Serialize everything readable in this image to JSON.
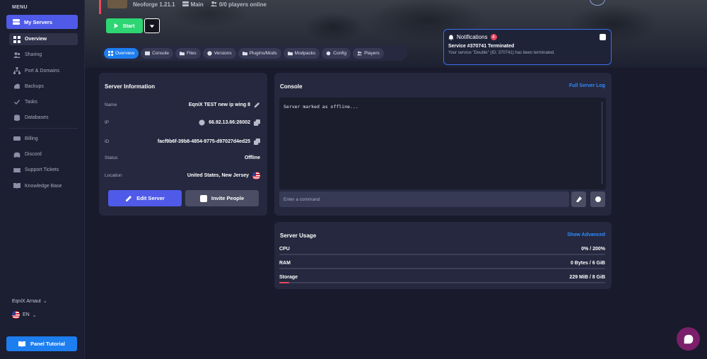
{
  "sidebar": {
    "menu_label": "MENU",
    "my_servers": "My Servers",
    "items": [
      {
        "label": "Overview",
        "icon": "grid-icon",
        "active": true
      },
      {
        "label": "Sharing",
        "icon": "users-icon"
      },
      {
        "label": "Port & Domains",
        "icon": "network-icon"
      },
      {
        "label": "Backups",
        "icon": "cloud-icon"
      },
      {
        "label": "Tasks",
        "icon": "tasks-icon"
      },
      {
        "label": "Databases",
        "icon": "database-icon"
      },
      {
        "label": "Billing",
        "icon": "billing-icon"
      },
      {
        "label": "Discord",
        "icon": "discord-icon"
      },
      {
        "label": "Support Tickets",
        "icon": "ticket-icon"
      },
      {
        "label": "Knowledge Base",
        "icon": "book-icon"
      }
    ],
    "user": "EqniX Arnaut",
    "language": "EN",
    "tutorial": "Panel Tutorial"
  },
  "header": {
    "version": "Neoforge 1.21.1",
    "node": "Main",
    "players": "0/0 players online",
    "start_label": "Start"
  },
  "tabs": [
    "Overview",
    "Console",
    "Files",
    "Versions",
    "Plugins/Mods",
    "Modpacks",
    "Config",
    "Players"
  ],
  "notification": {
    "header": "Notifications",
    "count": "4",
    "title": "Service #370741 Terminated",
    "text": "Your service \"Double\" (ID: 370741) has been terminated."
  },
  "server_info": {
    "title": "Server Information",
    "rows": [
      {
        "key": "Name",
        "value": "EqniX TEST new ip wing 8"
      },
      {
        "key": "IP",
        "value": "66.92.13.66:26002"
      },
      {
        "key": "ID",
        "value": "facf9b6f-39b8-4854-9775-d97027d4ed25"
      },
      {
        "key": "Status",
        "value": "Offline"
      },
      {
        "key": "Location",
        "value": "United States, New Jersey"
      }
    ],
    "edit_label": "Edit Server",
    "invite_label": "Invite People"
  },
  "console": {
    "title": "Console",
    "full_log": "Full Server Log",
    "output": "Server marked as offline...",
    "placeholder": "Enter a command"
  },
  "usage": {
    "title": "Server Usage",
    "show_advanced": "Show Advanced",
    "rows": [
      {
        "label": "CPU",
        "value": "0% / 200%",
        "fraction": 0.0,
        "color": "#3b3f58"
      },
      {
        "label": "RAM",
        "value": "0 Bytes / 6 GiB",
        "fraction": 0.0,
        "color": "#3b3f58"
      },
      {
        "label": "Storage",
        "value": "229 MiB / 8 GiB",
        "fraction": 0.028,
        "color": "#e84a5f"
      }
    ]
  },
  "colors": {
    "accent": "#4f5be8",
    "link": "#2f8cff",
    "start": "#2ed573",
    "danger": "#e84a5f"
  }
}
